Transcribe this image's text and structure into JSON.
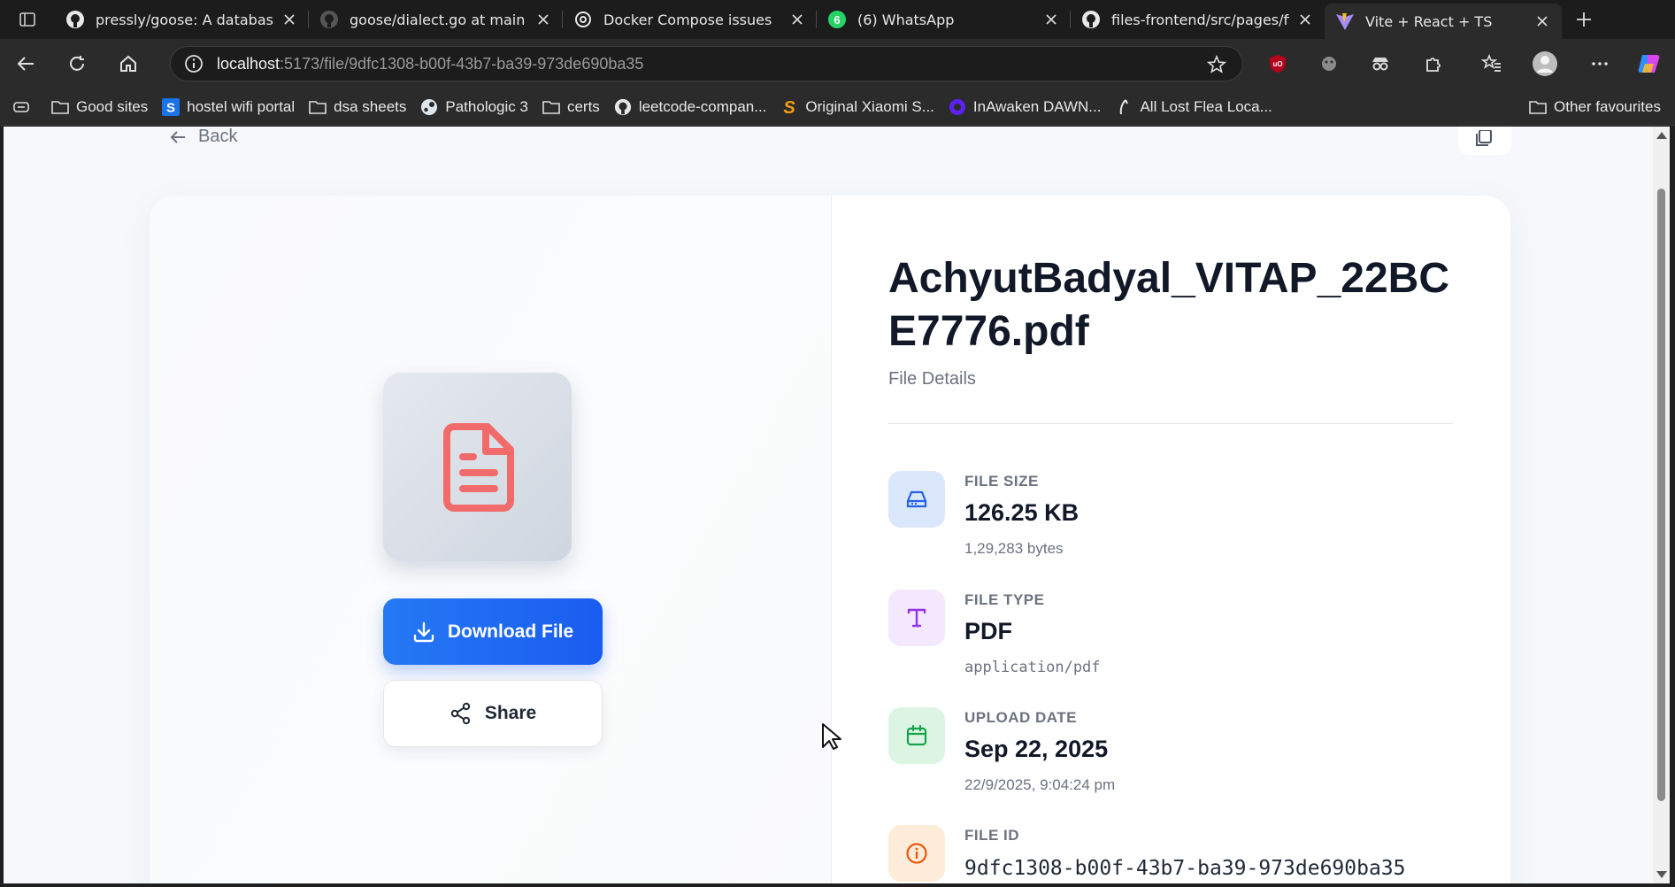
{
  "browser": {
    "tabs": [
      {
        "title": "pressly/goose: A database",
        "icon": "github-icon"
      },
      {
        "title": "goose/dialect.go at main · p",
        "icon": "github-icon"
      },
      {
        "title": "Docker Compose issues",
        "icon": "chatgpt-icon"
      },
      {
        "title": "(6) WhatsApp",
        "icon": "whatsapp-icon",
        "badge": "6"
      },
      {
        "title": "files-frontend/src/pages/fi",
        "icon": "github-icon"
      },
      {
        "title": "Vite + React + TS",
        "icon": "vite-icon",
        "active": true
      }
    ],
    "url_host": "localhost",
    "url_path": ":5173/file/9dfc1308-b00f-43b7-ba39-973de690ba35",
    "extension_badge": "uO",
    "bookmarks": [
      {
        "label": "Good sites",
        "icon": "folder-icon"
      },
      {
        "label": "hostel wifi portal",
        "icon": "s-logo-icon"
      },
      {
        "label": "dsa sheets",
        "icon": "folder-icon"
      },
      {
        "label": "Pathologic 3",
        "icon": "steam-icon"
      },
      {
        "label": "certs",
        "icon": "folder-icon"
      },
      {
        "label": "leetcode-compan...",
        "icon": "github-icon"
      },
      {
        "label": "Original Xiaomi S...",
        "icon": "s-brand-icon"
      },
      {
        "label": "InAwaken DAWN...",
        "icon": "discord-icon"
      },
      {
        "label": "All Lost Flea Loca...",
        "icon": "flea-icon"
      }
    ],
    "other_favourites": "Other favourites"
  },
  "page": {
    "back_label": "Back",
    "file_name": "AchyutBadyal_VITAP_22BCE7776.pdf",
    "subtitle": "File Details",
    "download_label": "Download File",
    "share_label": "Share",
    "details": [
      {
        "label": "FILE SIZE",
        "value": "126.25 KB",
        "sub": "1,29,283 bytes",
        "icon": "hard-drive-icon"
      },
      {
        "label": "FILE TYPE",
        "value": "PDF",
        "sub": "application/pdf",
        "icon": "type-icon"
      },
      {
        "label": "UPLOAD DATE",
        "value": "Sep 22, 2025",
        "sub": "22/9/2025, 9:04:24 pm",
        "icon": "calendar-icon"
      },
      {
        "label": "FILE ID",
        "value": "9dfc1308-b00f-43b7-ba39-973de690ba35",
        "icon": "info-icon"
      }
    ]
  },
  "colors": {
    "primary": "#1a5cf0",
    "file_icon": "#f26b6b",
    "size_icon": "#2563eb",
    "type_icon": "#9333ea",
    "date_icon": "#16a34a",
    "id_icon": "#ea580c"
  }
}
